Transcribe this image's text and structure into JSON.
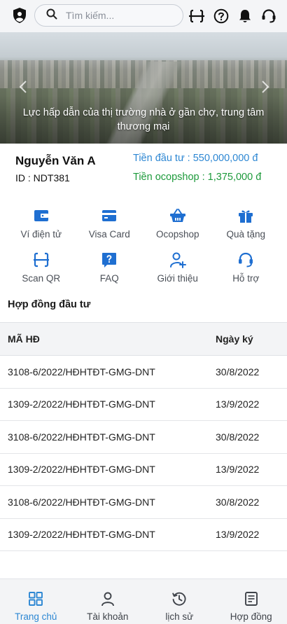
{
  "header": {
    "search_placeholder": "Tìm kiếm...",
    "icons": [
      "shield-user-icon",
      "search-icon",
      "scan-icon",
      "help-icon",
      "bell-icon",
      "headset-icon"
    ]
  },
  "banner": {
    "caption": "Lực hấp dẫn của thị trường nhà ở gần chợ, trung tâm thương mại"
  },
  "user": {
    "name": "Nguyễn Văn A",
    "id": "ID : NDT381",
    "investment": "Tiền đầu tư : 550,000,000 đ",
    "ocopshop": "Tiền ocopshop : 1,375,000 đ"
  },
  "actions": [
    {
      "label": "Ví điện tử",
      "icon": "wallet-icon"
    },
    {
      "label": "Visa Card",
      "icon": "credit-card-icon"
    },
    {
      "label": "Ocopshop",
      "icon": "basket-icon"
    },
    {
      "label": "Quà tặng",
      "icon": "gift-icon"
    },
    {
      "label": "Scan QR",
      "icon": "scan-icon"
    },
    {
      "label": "FAQ",
      "icon": "faq-icon"
    },
    {
      "label": "Giới thiệu",
      "icon": "user-plus-icon"
    },
    {
      "label": "Hỗ trợ",
      "icon": "headset-icon"
    }
  ],
  "contracts": {
    "title": "Hợp đồng đầu tư",
    "columns": [
      "MÃ HĐ",
      "Ngày ký"
    ],
    "rows": [
      [
        "3108-6/2022/HĐHTĐT-GMG-DNT",
        "30/8/2022"
      ],
      [
        "1309-2/2022/HĐHTĐT-GMG-DNT",
        "13/9/2022"
      ],
      [
        "3108-6/2022/HĐHTĐT-GMG-DNT",
        "30/8/2022"
      ],
      [
        "1309-2/2022/HĐHTĐT-GMG-DNT",
        "13/9/2022"
      ],
      [
        "3108-6/2022/HĐHTĐT-GMG-DNT",
        "30/8/2022"
      ],
      [
        "1309-2/2022/HĐHTĐT-GMG-DNT",
        "13/9/2022"
      ]
    ]
  },
  "nav": [
    {
      "label": "Trang chủ",
      "icon": "grid-icon",
      "active": true
    },
    {
      "label": "Tài khoản",
      "icon": "user-icon",
      "active": false
    },
    {
      "label": "lịch sử",
      "icon": "history-icon",
      "active": false
    },
    {
      "label": "Hợp đồng",
      "icon": "document-icon",
      "active": false
    }
  ],
  "colors": {
    "accent": "#2d87d3",
    "investment_text": "#2d87d3",
    "ocopshop_text": "#1d9a3b",
    "header_bg": "#f4f5f7"
  }
}
